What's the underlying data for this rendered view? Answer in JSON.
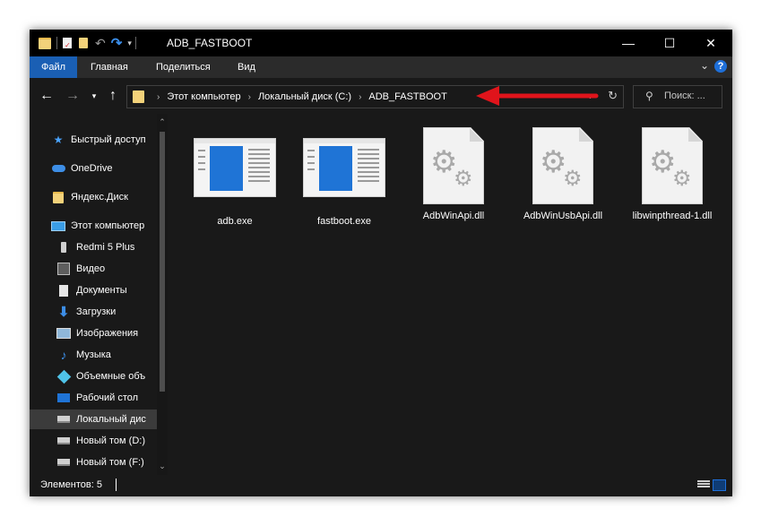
{
  "window": {
    "title": "ADB_FASTBOOT",
    "controls": {
      "minimize": "—",
      "maximize": "☐",
      "close": "✕"
    }
  },
  "ribbon": {
    "tabs": [
      "Файл",
      "Главная",
      "Поделиться",
      "Вид"
    ],
    "help": "?"
  },
  "navigation": {
    "breadcrumbs": [
      "Этот компьютер",
      "Локальный диск (C:)",
      "ADB_FASTBOOT"
    ],
    "search_placeholder": "Поиск: ..."
  },
  "sidebar": {
    "items": [
      {
        "label": "Быстрый доступ",
        "icon": "star-icon"
      },
      {
        "label": "OneDrive",
        "icon": "cloud-icon"
      },
      {
        "label": "Яндекс.Диск",
        "icon": "folder-icon"
      },
      {
        "label": "Этот компьютер",
        "icon": "computer-icon"
      },
      {
        "label": "Redmi 5 Plus",
        "icon": "phone-icon"
      },
      {
        "label": "Видео",
        "icon": "video-icon"
      },
      {
        "label": "Документы",
        "icon": "document-icon"
      },
      {
        "label": "Загрузки",
        "icon": "download-icon"
      },
      {
        "label": "Изображения",
        "icon": "image-icon"
      },
      {
        "label": "Музыка",
        "icon": "music-icon"
      },
      {
        "label": "Объемные объ",
        "icon": "cube-icon"
      },
      {
        "label": "Рабочий стол",
        "icon": "desktop-icon"
      },
      {
        "label": "Локальный дис",
        "icon": "drive-icon",
        "selected": true
      },
      {
        "label": "Новый том (D:)",
        "icon": "drive-icon"
      },
      {
        "label": "Новый том (F:)",
        "icon": "drive-icon"
      }
    ]
  },
  "files": [
    {
      "name": "adb.exe",
      "type": "exe"
    },
    {
      "name": "fastboot.exe",
      "type": "exe"
    },
    {
      "name": "AdbWinApi.dll",
      "type": "dll"
    },
    {
      "name": "AdbWinUsbApi.dll",
      "type": "dll"
    },
    {
      "name": "libwinpthread-1.dll",
      "type": "dll"
    }
  ],
  "status": {
    "items_count": "Элементов: 5"
  },
  "colors": {
    "accent": "#1a5fb4",
    "annotation": "#e0141b",
    "background": "#191919"
  }
}
